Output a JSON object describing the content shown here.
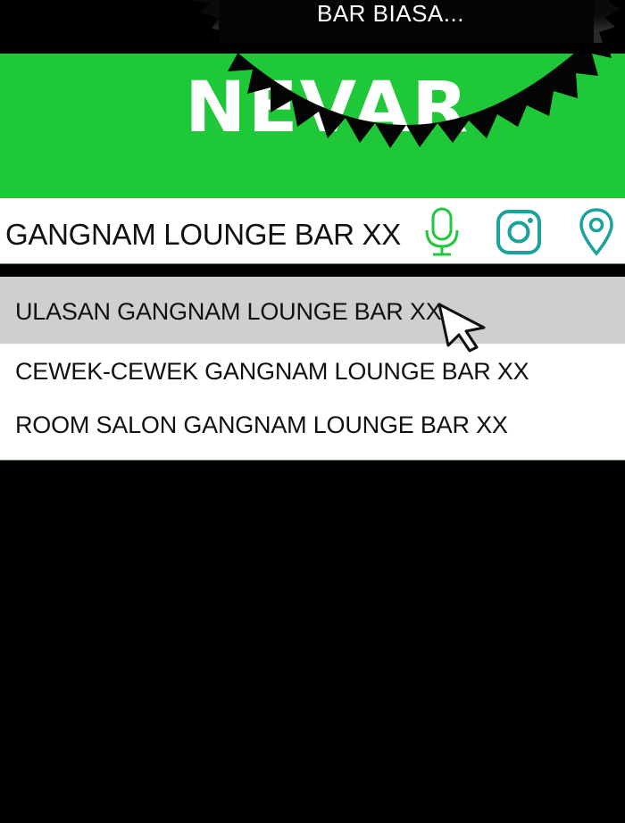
{
  "bubble": {
    "text": "BAR BIASA..."
  },
  "header": {
    "logo": "NEVAR",
    "bg_color": "#1ec838"
  },
  "search": {
    "query": "GANGNAM LOUNGE BAR XX",
    "icons": [
      "microphone-icon",
      "instagram-icon",
      "location-pin-icon"
    ]
  },
  "suggestions": [
    {
      "label": "ULASAN GANGNAM LOUNGE BAR XX",
      "highlighted": true
    },
    {
      "label": "CEWEK-CEWEK GANGNAM LOUNGE BAR XX",
      "highlighted": false
    },
    {
      "label": "ROOM SALON GANGNAM LOUNGE BAR XX",
      "highlighted": false
    }
  ],
  "colors": {
    "accent": "#1ec838",
    "icon_teal": "#19a39a",
    "highlight": "#cfcfcf"
  }
}
